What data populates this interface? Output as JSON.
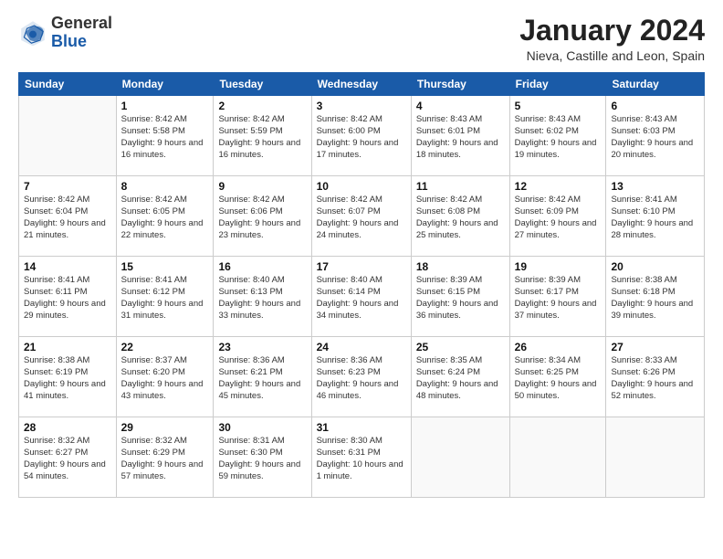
{
  "logo": {
    "general": "General",
    "blue": "Blue"
  },
  "header": {
    "month": "January 2024",
    "location": "Nieva, Castille and Leon, Spain"
  },
  "weekdays": [
    "Sunday",
    "Monday",
    "Tuesday",
    "Wednesday",
    "Thursday",
    "Friday",
    "Saturday"
  ],
  "weeks": [
    [
      {
        "day": "",
        "sunrise": "",
        "sunset": "",
        "daylight": ""
      },
      {
        "day": "1",
        "sunrise": "Sunrise: 8:42 AM",
        "sunset": "Sunset: 5:58 PM",
        "daylight": "Daylight: 9 hours and 16 minutes."
      },
      {
        "day": "2",
        "sunrise": "Sunrise: 8:42 AM",
        "sunset": "Sunset: 5:59 PM",
        "daylight": "Daylight: 9 hours and 16 minutes."
      },
      {
        "day": "3",
        "sunrise": "Sunrise: 8:42 AM",
        "sunset": "Sunset: 6:00 PM",
        "daylight": "Daylight: 9 hours and 17 minutes."
      },
      {
        "day": "4",
        "sunrise": "Sunrise: 8:43 AM",
        "sunset": "Sunset: 6:01 PM",
        "daylight": "Daylight: 9 hours and 18 minutes."
      },
      {
        "day": "5",
        "sunrise": "Sunrise: 8:43 AM",
        "sunset": "Sunset: 6:02 PM",
        "daylight": "Daylight: 9 hours and 19 minutes."
      },
      {
        "day": "6",
        "sunrise": "Sunrise: 8:43 AM",
        "sunset": "Sunset: 6:03 PM",
        "daylight": "Daylight: 9 hours and 20 minutes."
      }
    ],
    [
      {
        "day": "7",
        "sunrise": "Sunrise: 8:42 AM",
        "sunset": "Sunset: 6:04 PM",
        "daylight": "Daylight: 9 hours and 21 minutes."
      },
      {
        "day": "8",
        "sunrise": "Sunrise: 8:42 AM",
        "sunset": "Sunset: 6:05 PM",
        "daylight": "Daylight: 9 hours and 22 minutes."
      },
      {
        "day": "9",
        "sunrise": "Sunrise: 8:42 AM",
        "sunset": "Sunset: 6:06 PM",
        "daylight": "Daylight: 9 hours and 23 minutes."
      },
      {
        "day": "10",
        "sunrise": "Sunrise: 8:42 AM",
        "sunset": "Sunset: 6:07 PM",
        "daylight": "Daylight: 9 hours and 24 minutes."
      },
      {
        "day": "11",
        "sunrise": "Sunrise: 8:42 AM",
        "sunset": "Sunset: 6:08 PM",
        "daylight": "Daylight: 9 hours and 25 minutes."
      },
      {
        "day": "12",
        "sunrise": "Sunrise: 8:42 AM",
        "sunset": "Sunset: 6:09 PM",
        "daylight": "Daylight: 9 hours and 27 minutes."
      },
      {
        "day": "13",
        "sunrise": "Sunrise: 8:41 AM",
        "sunset": "Sunset: 6:10 PM",
        "daylight": "Daylight: 9 hours and 28 minutes."
      }
    ],
    [
      {
        "day": "14",
        "sunrise": "Sunrise: 8:41 AM",
        "sunset": "Sunset: 6:11 PM",
        "daylight": "Daylight: 9 hours and 29 minutes."
      },
      {
        "day": "15",
        "sunrise": "Sunrise: 8:41 AM",
        "sunset": "Sunset: 6:12 PM",
        "daylight": "Daylight: 9 hours and 31 minutes."
      },
      {
        "day": "16",
        "sunrise": "Sunrise: 8:40 AM",
        "sunset": "Sunset: 6:13 PM",
        "daylight": "Daylight: 9 hours and 33 minutes."
      },
      {
        "day": "17",
        "sunrise": "Sunrise: 8:40 AM",
        "sunset": "Sunset: 6:14 PM",
        "daylight": "Daylight: 9 hours and 34 minutes."
      },
      {
        "day": "18",
        "sunrise": "Sunrise: 8:39 AM",
        "sunset": "Sunset: 6:15 PM",
        "daylight": "Daylight: 9 hours and 36 minutes."
      },
      {
        "day": "19",
        "sunrise": "Sunrise: 8:39 AM",
        "sunset": "Sunset: 6:17 PM",
        "daylight": "Daylight: 9 hours and 37 minutes."
      },
      {
        "day": "20",
        "sunrise": "Sunrise: 8:38 AM",
        "sunset": "Sunset: 6:18 PM",
        "daylight": "Daylight: 9 hours and 39 minutes."
      }
    ],
    [
      {
        "day": "21",
        "sunrise": "Sunrise: 8:38 AM",
        "sunset": "Sunset: 6:19 PM",
        "daylight": "Daylight: 9 hours and 41 minutes."
      },
      {
        "day": "22",
        "sunrise": "Sunrise: 8:37 AM",
        "sunset": "Sunset: 6:20 PM",
        "daylight": "Daylight: 9 hours and 43 minutes."
      },
      {
        "day": "23",
        "sunrise": "Sunrise: 8:36 AM",
        "sunset": "Sunset: 6:21 PM",
        "daylight": "Daylight: 9 hours and 45 minutes."
      },
      {
        "day": "24",
        "sunrise": "Sunrise: 8:36 AM",
        "sunset": "Sunset: 6:23 PM",
        "daylight": "Daylight: 9 hours and 46 minutes."
      },
      {
        "day": "25",
        "sunrise": "Sunrise: 8:35 AM",
        "sunset": "Sunset: 6:24 PM",
        "daylight": "Daylight: 9 hours and 48 minutes."
      },
      {
        "day": "26",
        "sunrise": "Sunrise: 8:34 AM",
        "sunset": "Sunset: 6:25 PM",
        "daylight": "Daylight: 9 hours and 50 minutes."
      },
      {
        "day": "27",
        "sunrise": "Sunrise: 8:33 AM",
        "sunset": "Sunset: 6:26 PM",
        "daylight": "Daylight: 9 hours and 52 minutes."
      }
    ],
    [
      {
        "day": "28",
        "sunrise": "Sunrise: 8:32 AM",
        "sunset": "Sunset: 6:27 PM",
        "daylight": "Daylight: 9 hours and 54 minutes."
      },
      {
        "day": "29",
        "sunrise": "Sunrise: 8:32 AM",
        "sunset": "Sunset: 6:29 PM",
        "daylight": "Daylight: 9 hours and 57 minutes."
      },
      {
        "day": "30",
        "sunrise": "Sunrise: 8:31 AM",
        "sunset": "Sunset: 6:30 PM",
        "daylight": "Daylight: 9 hours and 59 minutes."
      },
      {
        "day": "31",
        "sunrise": "Sunrise: 8:30 AM",
        "sunset": "Sunset: 6:31 PM",
        "daylight": "Daylight: 10 hours and 1 minute."
      },
      {
        "day": "",
        "sunrise": "",
        "sunset": "",
        "daylight": ""
      },
      {
        "day": "",
        "sunrise": "",
        "sunset": "",
        "daylight": ""
      },
      {
        "day": "",
        "sunrise": "",
        "sunset": "",
        "daylight": ""
      }
    ]
  ]
}
